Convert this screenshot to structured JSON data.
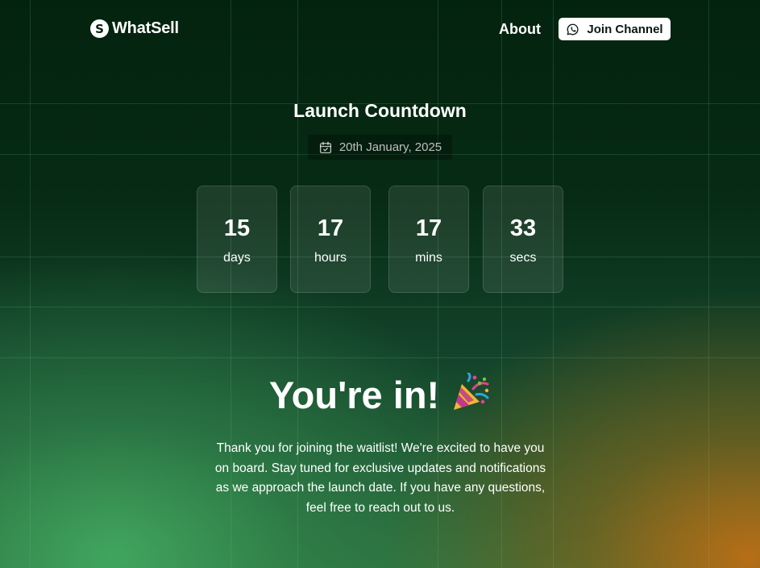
{
  "header": {
    "brand_name": "WhatSell",
    "brand_icon": "whatsell-s-logo-icon",
    "nav": {
      "about_label": "About"
    },
    "join_button": {
      "label": "Join Channel",
      "icon": "whatsapp-icon"
    }
  },
  "countdown": {
    "title": "Launch Countdown",
    "date_icon": "calendar-check-icon",
    "date": "20th January, 2025",
    "units": [
      {
        "value": "15",
        "label": "days"
      },
      {
        "value": "17",
        "label": "hours"
      },
      {
        "value": "17",
        "label": "mins"
      },
      {
        "value": "33",
        "label": "secs"
      }
    ]
  },
  "confirmation": {
    "headline": "You're in!",
    "emoji": "party-popper-icon",
    "message": "Thank you for joining the waitlist! We're excited to have you on board. Stay tuned for exclusive updates and notifications as we approach the launch date. If you have any questions, feel free to reach out to us."
  },
  "colors": {
    "background_top": "#03230f",
    "glow_green": "#42a860",
    "glow_orange": "#be6e14",
    "button_bg": "#ffffff"
  }
}
